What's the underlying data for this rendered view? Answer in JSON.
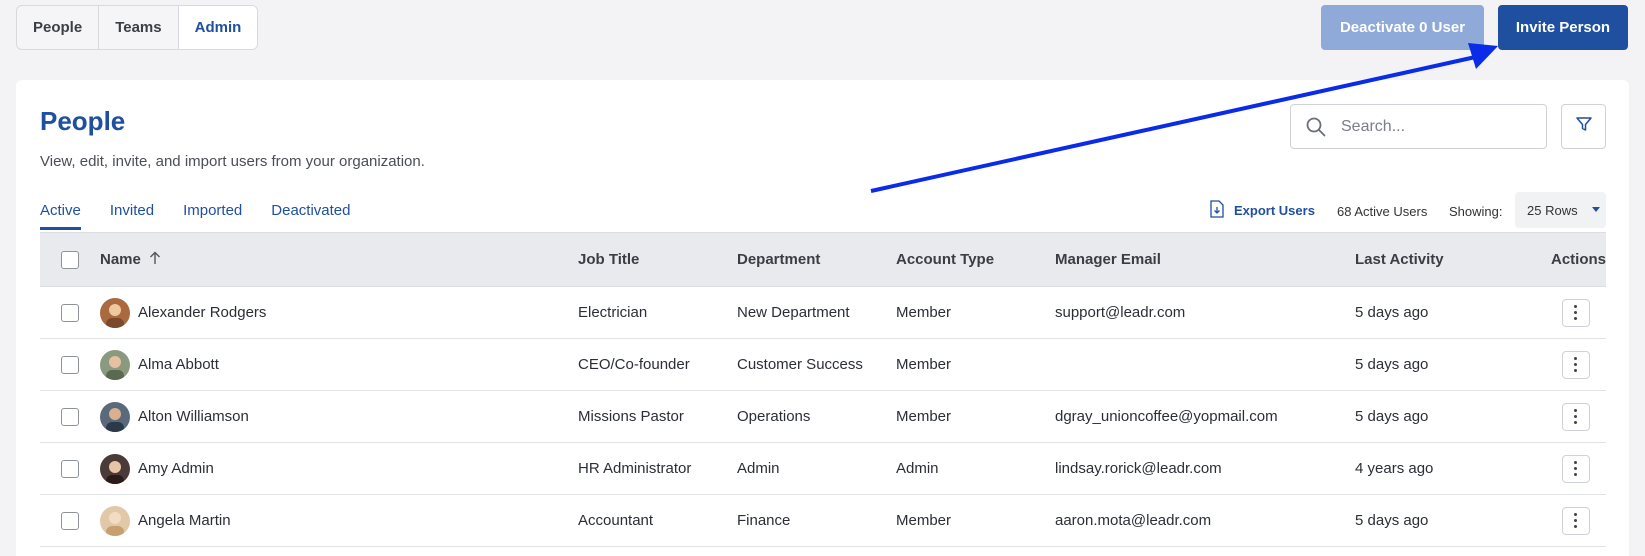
{
  "top_tabs": [
    {
      "label": "People"
    },
    {
      "label": "Teams"
    },
    {
      "label": "Admin",
      "active": true
    }
  ],
  "header_buttons": {
    "deactivate_label": "Deactivate 0 User",
    "invite_label": "Invite Person"
  },
  "page": {
    "title": "People",
    "subtitle": "View, edit, invite, and import users from your organization."
  },
  "search": {
    "placeholder": "Search...",
    "icon": "search-icon"
  },
  "filter": {
    "icon": "filter-icon"
  },
  "status_tabs": [
    {
      "label": "Active",
      "active": true
    },
    {
      "label": "Invited"
    },
    {
      "label": "Imported"
    },
    {
      "label": "Deactivated"
    }
  ],
  "toolbar": {
    "export_label": "Export Users",
    "active_count": "68 Active Users",
    "showing_label": "Showing:",
    "rows_value": "25 Rows"
  },
  "table": {
    "headers": {
      "name": "Name",
      "job_title": "Job Title",
      "department": "Department",
      "account_type": "Account Type",
      "manager_email": "Manager Email",
      "last_activity": "Last Activity",
      "actions": "Actions"
    },
    "rows": [
      {
        "name": "Alexander Rodgers",
        "job_title": "Electrician",
        "department": "New Department",
        "account_type": "Member",
        "manager_email": "support@leadr.com",
        "last_activity": "5 days ago"
      },
      {
        "name": "Alma Abbott",
        "job_title": "CEO/Co-founder",
        "department": "Customer Success",
        "account_type": "Member",
        "manager_email": "",
        "last_activity": "5 days ago"
      },
      {
        "name": "Alton Williamson",
        "job_title": "Missions Pastor",
        "department": "Operations",
        "account_type": "Member",
        "manager_email": "dgray_unioncoffee@yopmail.com",
        "last_activity": "5 days ago"
      },
      {
        "name": "Amy Admin",
        "job_title": "HR Administrator",
        "department": "Admin",
        "account_type": "Admin",
        "manager_email": "lindsay.rorick@leadr.com",
        "last_activity": "4 years ago"
      },
      {
        "name": "Angela Martin",
        "job_title": "Accountant",
        "department": "Finance",
        "account_type": "Member",
        "manager_email": "aaron.mota@leadr.com",
        "last_activity": "5 days ago"
      }
    ]
  },
  "colors": {
    "brand": "#1f4f9f",
    "annotation_arrow": "#0a2be8"
  }
}
